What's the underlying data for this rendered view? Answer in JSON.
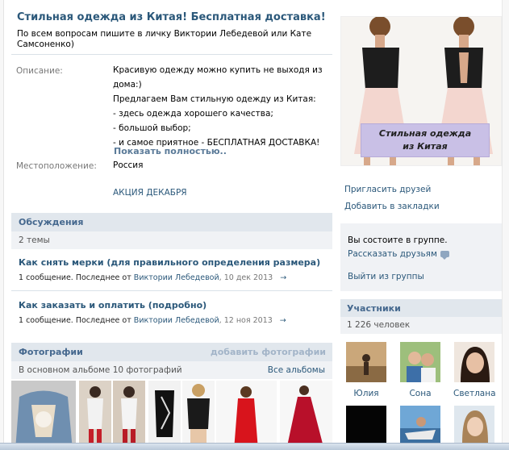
{
  "group": {
    "title": "Стильная одежда из Китая! Бесплатная доставка!",
    "status": "По всем вопросам пишите в личку Виктории Лебедевой или Кате Самсоненко)"
  },
  "info": {
    "description_label": "Описание:",
    "description_lines": [
      "Красивую одежду можно купить не выходя из",
      "дома:)",
      "Предлагаем Вам стильную одежду из Китая:",
      "- здесь одежда хорошего качества;",
      "- большой выбор;",
      "- и самое приятное - БЕСПЛАТНАЯ ДОСТАВКА!"
    ],
    "show_more": "Показать полностью..",
    "location_label": "Местоположение:",
    "location_value": "Россия",
    "promo_link": "АКЦИЯ ДЕКАБРЯ"
  },
  "discussions": {
    "title": "Обсуждения",
    "count": "2 темы",
    "topics": [
      {
        "title": "Как снять мерки (для правильного определения размера)",
        "meta_prefix": "1 сообщение. Последнее от",
        "author": "Виктории Лебедевой",
        "date": ", 10 дек 2013",
        "arrow": "→"
      },
      {
        "title": "Как заказать и оплатить (подробно)",
        "meta_prefix": "1 сообщение. Последнее от",
        "author": "Виктории Лебедевой",
        "date": ", 12 ноя 2013",
        "arrow": "→"
      }
    ]
  },
  "photos": {
    "title": "Фотографии",
    "add_link": "добавить фотографии",
    "album_info": "В основном альбоме 10 фотографий",
    "all_albums": "Все альбомы"
  },
  "sidebar": {
    "cover_caption_line1": "Стильная одежда",
    "cover_caption_line2": "из Китая",
    "invite_friends": "Пригласить друзей",
    "add_bookmark": "Добавить в закладки",
    "member_status": "Вы состоите в группе.",
    "tell_friends": "Рассказать друзьям",
    "leave_group": "Выйти из группы",
    "members_title": "Участники",
    "members_count": "1 226 человек",
    "members": [
      {
        "name": "Юлия"
      },
      {
        "name": "Сона"
      },
      {
        "name": "Светлана"
      }
    ]
  },
  "colors": {
    "link": "#2b587a",
    "block_header_bg": "#e1e7ed",
    "block_sub_bg": "#f0f2f5",
    "cover_label_bg": "#c9c0e6"
  }
}
